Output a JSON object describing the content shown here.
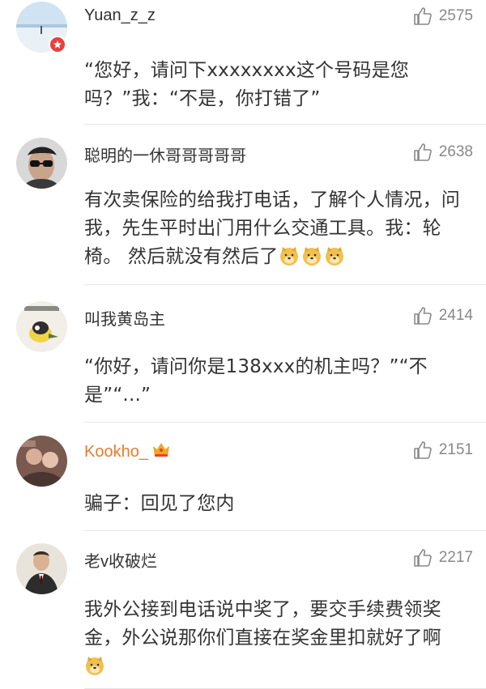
{
  "comments": [
    {
      "username": "Yuan_z_z",
      "likes": "2575",
      "text": "“您好，请问下xxxxxxxx这个号码是您吗？”我：“不是，你打错了”",
      "has_badge": true
    },
    {
      "username": "聪明的一休哥哥哥哥哥",
      "likes": "2638",
      "text": "有次卖保险的给我打电话，了解个人情况，问我，先生平时出门用什么交通工具。我：轮椅。 然后就没有然后了"
    },
    {
      "username": "叫我黄岛主",
      "likes": "2414",
      "text": "“你好，请问你是138xxx的机主吗？”“不是”“...”"
    },
    {
      "username": "Kookho_",
      "likes": "2151",
      "text": "骗子：回见了您内",
      "username_color": "#eb7a2c"
    },
    {
      "username": "老v收破烂",
      "likes": "2217",
      "text": "我外公接到电话说中奖了，要交手续费领奖金，外公说那你们直接在奖金里扣就好了啊"
    }
  ]
}
